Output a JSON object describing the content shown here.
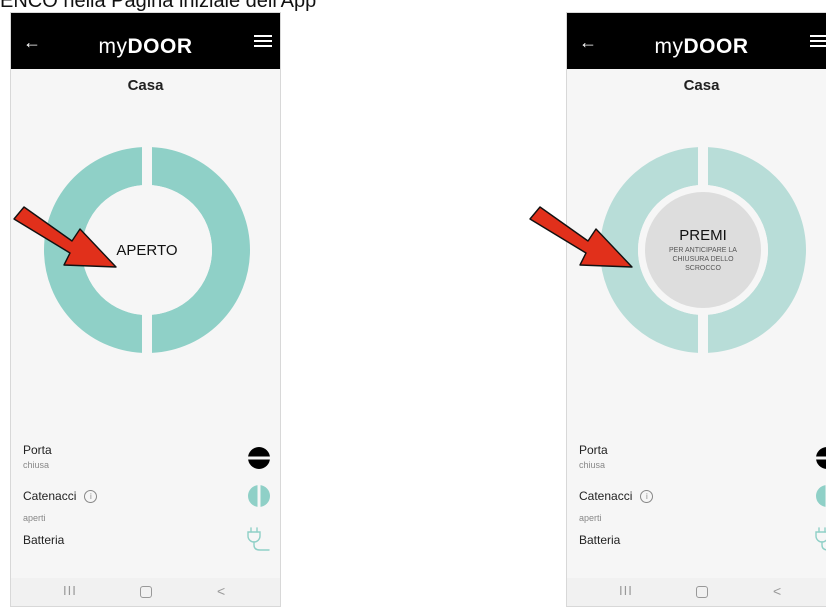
{
  "caption": "ENCO  nella Pagina iniziale dell'App",
  "colors": {
    "ring_left": "#8fd0c7",
    "ring_right": "#b8ddd8",
    "arrow": "#e1301b",
    "topbar": "#000000"
  },
  "screens": [
    {
      "header": {
        "back_icon": "back-arrow-icon",
        "logo_my": "my",
        "logo_door": "DOOR",
        "menu_icon": "hamburger-menu-icon"
      },
      "title": "Casa",
      "main_button": {
        "label": "APERTO"
      },
      "status": [
        {
          "label": "Porta",
          "sub": "chiusa",
          "icon": "door-closed-icon"
        },
        {
          "label": "Catenacci",
          "info_icon": "info-icon",
          "info": "i",
          "sub": "aperti",
          "icon": "bolts-open-icon"
        },
        {
          "label": "Batteria",
          "icon": "power-plug-icon"
        }
      ],
      "navbar": {
        "recents": "III",
        "home": "home-icon",
        "back": "<"
      }
    },
    {
      "header": {
        "back_icon": "back-arrow-icon",
        "logo_my": "my",
        "logo_door": "DOOR",
        "menu_icon": "hamburger-menu-icon"
      },
      "title": "Casa",
      "main_button": {
        "label": "PREMI",
        "sub": "PER ANTICIPARE LA CHIUSURA DELLO SCROCCO"
      },
      "status": [
        {
          "label": "Porta",
          "sub": "chiusa",
          "icon": "door-closed-icon"
        },
        {
          "label": "Catenacci",
          "info_icon": "info-icon",
          "info": "i",
          "sub": "aperti",
          "icon": "bolts-open-icon"
        },
        {
          "label": "Batteria",
          "icon": "power-plug-icon"
        }
      ],
      "navbar": {
        "recents": "III",
        "home": "home-icon",
        "back": "<"
      }
    }
  ]
}
